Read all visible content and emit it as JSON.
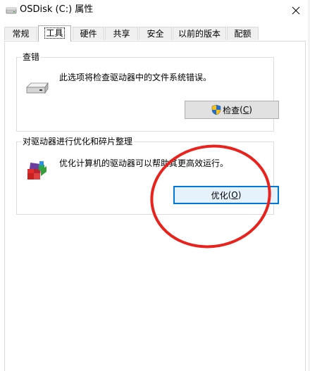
{
  "window": {
    "title": "OSDisk (C:) 属性",
    "close_glyph": "✕"
  },
  "tabs": [
    {
      "label": "常规",
      "active": false
    },
    {
      "label": "工具",
      "active": true
    },
    {
      "label": "硬件",
      "active": false
    },
    {
      "label": "共享",
      "active": false
    },
    {
      "label": "安全",
      "active": false
    },
    {
      "label": "以前的版本",
      "active": false
    },
    {
      "label": "配额",
      "active": false
    }
  ],
  "error_check": {
    "title": "查错",
    "description": "此选项将检查驱动器中的文件系统错误。",
    "button_label": "检查",
    "button_accel_prefix": "(",
    "button_accel_key": "C",
    "button_accel_suffix": ")",
    "icon": "drive-icon"
  },
  "optimize": {
    "title": "对驱动器进行优化和碎片整理",
    "description": "优化计算机的驱动器可以帮助其更高效运行。",
    "button_label": "优化",
    "button_accel_prefix": "(",
    "button_accel_key": "O",
    "button_accel_suffix": ")",
    "icon": "defrag-icon"
  },
  "colors": {
    "accent": "#0078d7",
    "annotation": "#e8221c",
    "button_face": "#e1e1e1",
    "hot_button_face": "#e5f1fb"
  }
}
